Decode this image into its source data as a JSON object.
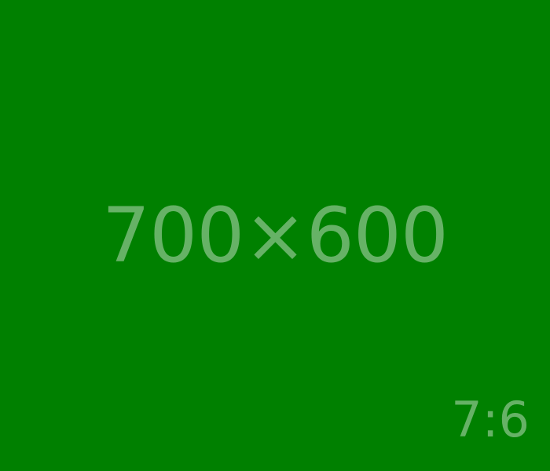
{
  "placeholder": {
    "dimensions_text": "700×600",
    "ratio_text": "7:6"
  },
  "colors": {
    "background": "#008000",
    "text": "#66B266"
  }
}
